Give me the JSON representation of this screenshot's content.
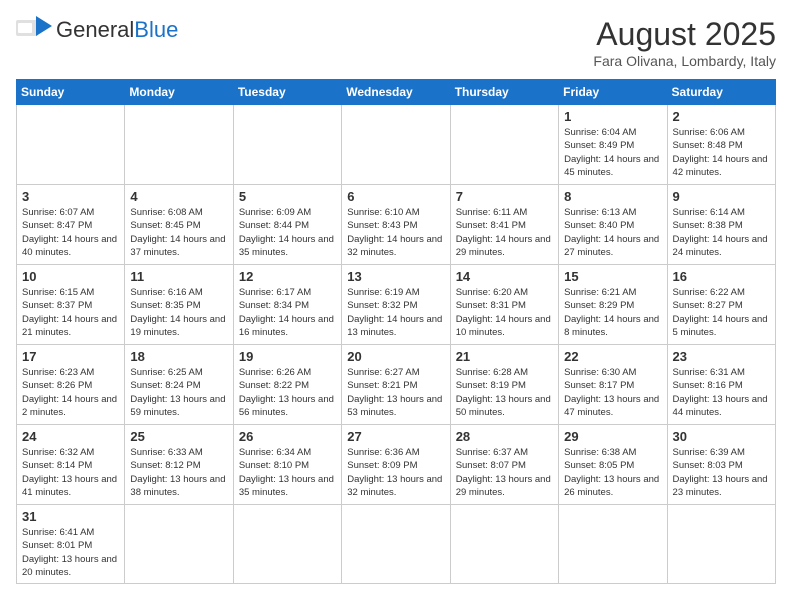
{
  "logo": {
    "text_general": "General",
    "text_blue": "Blue"
  },
  "calendar": {
    "title": "August 2025",
    "subtitle": "Fara Olivana, Lombardy, Italy"
  },
  "weekdays": [
    "Sunday",
    "Monday",
    "Tuesday",
    "Wednesday",
    "Thursday",
    "Friday",
    "Saturday"
  ],
  "weeks": [
    [
      {
        "day": "",
        "info": ""
      },
      {
        "day": "",
        "info": ""
      },
      {
        "day": "",
        "info": ""
      },
      {
        "day": "",
        "info": ""
      },
      {
        "day": "",
        "info": ""
      },
      {
        "day": "1",
        "info": "Sunrise: 6:04 AM\nSunset: 8:49 PM\nDaylight: 14 hours and 45 minutes."
      },
      {
        "day": "2",
        "info": "Sunrise: 6:06 AM\nSunset: 8:48 PM\nDaylight: 14 hours and 42 minutes."
      }
    ],
    [
      {
        "day": "3",
        "info": "Sunrise: 6:07 AM\nSunset: 8:47 PM\nDaylight: 14 hours and 40 minutes."
      },
      {
        "day": "4",
        "info": "Sunrise: 6:08 AM\nSunset: 8:45 PM\nDaylight: 14 hours and 37 minutes."
      },
      {
        "day": "5",
        "info": "Sunrise: 6:09 AM\nSunset: 8:44 PM\nDaylight: 14 hours and 35 minutes."
      },
      {
        "day": "6",
        "info": "Sunrise: 6:10 AM\nSunset: 8:43 PM\nDaylight: 14 hours and 32 minutes."
      },
      {
        "day": "7",
        "info": "Sunrise: 6:11 AM\nSunset: 8:41 PM\nDaylight: 14 hours and 29 minutes."
      },
      {
        "day": "8",
        "info": "Sunrise: 6:13 AM\nSunset: 8:40 PM\nDaylight: 14 hours and 27 minutes."
      },
      {
        "day": "9",
        "info": "Sunrise: 6:14 AM\nSunset: 8:38 PM\nDaylight: 14 hours and 24 minutes."
      }
    ],
    [
      {
        "day": "10",
        "info": "Sunrise: 6:15 AM\nSunset: 8:37 PM\nDaylight: 14 hours and 21 minutes."
      },
      {
        "day": "11",
        "info": "Sunrise: 6:16 AM\nSunset: 8:35 PM\nDaylight: 14 hours and 19 minutes."
      },
      {
        "day": "12",
        "info": "Sunrise: 6:17 AM\nSunset: 8:34 PM\nDaylight: 14 hours and 16 minutes."
      },
      {
        "day": "13",
        "info": "Sunrise: 6:19 AM\nSunset: 8:32 PM\nDaylight: 14 hours and 13 minutes."
      },
      {
        "day": "14",
        "info": "Sunrise: 6:20 AM\nSunset: 8:31 PM\nDaylight: 14 hours and 10 minutes."
      },
      {
        "day": "15",
        "info": "Sunrise: 6:21 AM\nSunset: 8:29 PM\nDaylight: 14 hours and 8 minutes."
      },
      {
        "day": "16",
        "info": "Sunrise: 6:22 AM\nSunset: 8:27 PM\nDaylight: 14 hours and 5 minutes."
      }
    ],
    [
      {
        "day": "17",
        "info": "Sunrise: 6:23 AM\nSunset: 8:26 PM\nDaylight: 14 hours and 2 minutes."
      },
      {
        "day": "18",
        "info": "Sunrise: 6:25 AM\nSunset: 8:24 PM\nDaylight: 13 hours and 59 minutes."
      },
      {
        "day": "19",
        "info": "Sunrise: 6:26 AM\nSunset: 8:22 PM\nDaylight: 13 hours and 56 minutes."
      },
      {
        "day": "20",
        "info": "Sunrise: 6:27 AM\nSunset: 8:21 PM\nDaylight: 13 hours and 53 minutes."
      },
      {
        "day": "21",
        "info": "Sunrise: 6:28 AM\nSunset: 8:19 PM\nDaylight: 13 hours and 50 minutes."
      },
      {
        "day": "22",
        "info": "Sunrise: 6:30 AM\nSunset: 8:17 PM\nDaylight: 13 hours and 47 minutes."
      },
      {
        "day": "23",
        "info": "Sunrise: 6:31 AM\nSunset: 8:16 PM\nDaylight: 13 hours and 44 minutes."
      }
    ],
    [
      {
        "day": "24",
        "info": "Sunrise: 6:32 AM\nSunset: 8:14 PM\nDaylight: 13 hours and 41 minutes."
      },
      {
        "day": "25",
        "info": "Sunrise: 6:33 AM\nSunset: 8:12 PM\nDaylight: 13 hours and 38 minutes."
      },
      {
        "day": "26",
        "info": "Sunrise: 6:34 AM\nSunset: 8:10 PM\nDaylight: 13 hours and 35 minutes."
      },
      {
        "day": "27",
        "info": "Sunrise: 6:36 AM\nSunset: 8:09 PM\nDaylight: 13 hours and 32 minutes."
      },
      {
        "day": "28",
        "info": "Sunrise: 6:37 AM\nSunset: 8:07 PM\nDaylight: 13 hours and 29 minutes."
      },
      {
        "day": "29",
        "info": "Sunrise: 6:38 AM\nSunset: 8:05 PM\nDaylight: 13 hours and 26 minutes."
      },
      {
        "day": "30",
        "info": "Sunrise: 6:39 AM\nSunset: 8:03 PM\nDaylight: 13 hours and 23 minutes."
      }
    ],
    [
      {
        "day": "31",
        "info": "Sunrise: 6:41 AM\nSunset: 8:01 PM\nDaylight: 13 hours and 20 minutes."
      },
      {
        "day": "",
        "info": ""
      },
      {
        "day": "",
        "info": ""
      },
      {
        "day": "",
        "info": ""
      },
      {
        "day": "",
        "info": ""
      },
      {
        "day": "",
        "info": ""
      },
      {
        "day": "",
        "info": ""
      }
    ]
  ]
}
